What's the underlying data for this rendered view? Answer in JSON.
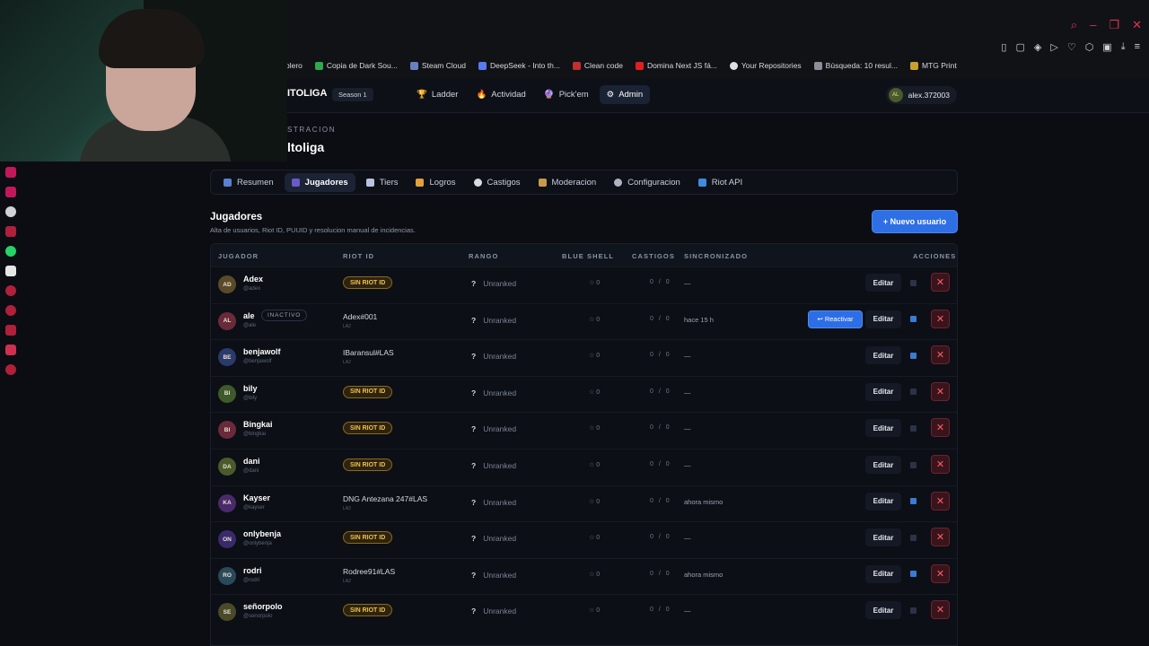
{
  "bookmarks": [
    "blero",
    "Copia de Dark Sou...",
    "Steam Cloud",
    "DeepSeek - Into th...",
    "Clean code",
    "Domina Next JS fá...",
    "Your Repositories",
    "Búsqueda: 10 resul...",
    "MTG Print"
  ],
  "nav": {
    "brand": "ITOLIGA",
    "season": "Season 1",
    "links": [
      "Ladder",
      "Actividad",
      "Pick'em",
      "Admin"
    ],
    "user": "alex.372003",
    "user_initials": "AL"
  },
  "header": {
    "eyebrow": "STRACION",
    "title": "ltoliga"
  },
  "tabs": [
    "Resumen",
    "Jugadores",
    "Tiers",
    "Logros",
    "Castigos",
    "Moderacion",
    "Configuracion",
    "Riot API"
  ],
  "section": {
    "title": "Jugadores",
    "description": "Alta de usuarios, Riot ID, PUUID y resolucion manual de incidencias.",
    "new_user_button": "+ Nuevo usuario"
  },
  "table": {
    "headers": [
      "JUGADOR",
      "RIOT ID",
      "RANGO",
      "BLUE SHELL",
      "CASTIGOS",
      "SINCRONIZADO",
      "ACCIONES"
    ],
    "sin_riot_label": "SIN RIOT ID",
    "rank_label": "Unranked",
    "edit_label": "Editar",
    "reactivate_label": "↩ Reactivar",
    "inactive_label": "INACTIVO",
    "rows": [
      {
        "initials": "AD",
        "name": "Adex",
        "handle": "@adex",
        "riot": "",
        "region": "",
        "blue": "0",
        "cast": "0 / 0",
        "sync": "—",
        "color": "#5a4a2a"
      },
      {
        "initials": "AL",
        "name": "ale",
        "handle": "@ale",
        "riot": "Adex#001",
        "region": "LA2",
        "blue": "0",
        "cast": "0 / 0",
        "sync": "hace 15 h",
        "color": "#6a2a3a"
      },
      {
        "initials": "BE",
        "name": "benjawolf",
        "handle": "@benjawolf",
        "riot": "IBaransul#LAS",
        "region": "LA2",
        "blue": "0",
        "cast": "0 / 0",
        "sync": "—",
        "color": "#2a3a6a"
      },
      {
        "initials": "BI",
        "name": "bily",
        "handle": "@bily",
        "riot": "",
        "region": "",
        "blue": "0",
        "cast": "0 / 0",
        "sync": "—",
        "color": "#3f5a2a"
      },
      {
        "initials": "BI",
        "name": "Bingkai",
        "handle": "@bingkai",
        "riot": "",
        "region": "",
        "blue": "0",
        "cast": "0 / 0",
        "sync": "—",
        "color": "#6a2a3a"
      },
      {
        "initials": "DA",
        "name": "dani",
        "handle": "@dani",
        "riot": "",
        "region": "",
        "blue": "0",
        "cast": "0 / 0",
        "sync": "—",
        "color": "#4a5a2a"
      },
      {
        "initials": "KA",
        "name": "Kayser",
        "handle": "@kayser",
        "riot": "DNG Antezana 247#LAS",
        "region": "LA2",
        "blue": "0",
        "cast": "0 / 0",
        "sync": "ahora mismo",
        "color": "#4a2a6a"
      },
      {
        "initials": "ON",
        "name": "onlybenja",
        "handle": "@onlybenja",
        "riot": "",
        "region": "",
        "blue": "0",
        "cast": "0 / 0",
        "sync": "—",
        "color": "#3a2a6a"
      },
      {
        "initials": "RO",
        "name": "rodri",
        "handle": "@rodri",
        "riot": "Rodree91#LAS",
        "region": "LA2",
        "blue": "0",
        "cast": "0 / 0",
        "sync": "ahora mismo",
        "color": "#2a4a5a"
      },
      {
        "initials": "SE",
        "name": "señorpolo",
        "handle": "@senorpolo",
        "riot": "",
        "region": "",
        "blue": "0",
        "cast": "0 / 0",
        "sync": "—",
        "color": "#4a4a2a"
      }
    ]
  }
}
